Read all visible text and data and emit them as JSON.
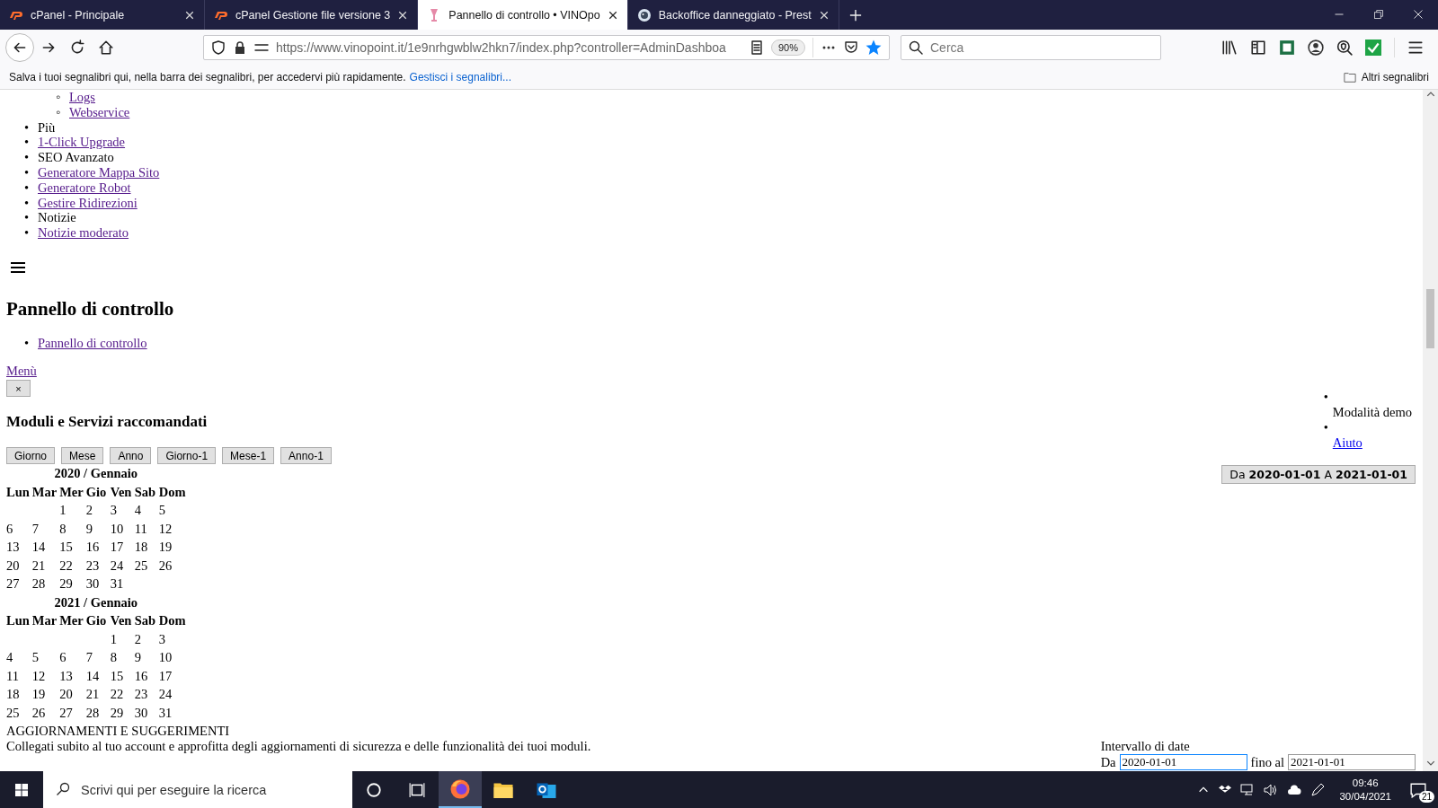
{
  "browser": {
    "tabs": [
      {
        "kind": "cpanel",
        "title": "cPanel - Principale",
        "selected": false
      },
      {
        "kind": "cpanel",
        "title": "cPanel Gestione file versione 3",
        "selected": false
      },
      {
        "kind": "wine",
        "title": "Pannello di controllo • VINOpo",
        "selected": true
      },
      {
        "kind": "prestashop",
        "title": "Backoffice danneggiato - Prest",
        "selected": false
      }
    ],
    "url": "https://www.vinopoint.it/1e9nrhgwblw2hkn7/index.php?controller=AdminDashboa",
    "zoom": "90%",
    "search": {
      "placeholder": "Cerca"
    },
    "bookmarks_bar": {
      "message": "Salva i tuoi segnalibri qui, nella barra dei segnalibri, per accedervi più rapidamente.",
      "link": "Gestisci i segnalibri...",
      "other": "Altri segnalibri"
    }
  },
  "page": {
    "nav_subitems": [
      {
        "marker": "◦",
        "label": "Logs",
        "visited": true
      },
      {
        "marker": "◦",
        "label": "Webservice",
        "visited": true
      }
    ],
    "nav_items": [
      {
        "kind": "text",
        "marker": "•",
        "label": "Più"
      },
      {
        "kind": "link",
        "marker": "•",
        "label": "1-Click Upgrade",
        "visited": true
      },
      {
        "kind": "text",
        "marker": "•",
        "label": "SEO Avanzato"
      },
      {
        "kind": "link",
        "marker": "•",
        "label": "Generatore Mappa Sito",
        "visited": true
      },
      {
        "kind": "link",
        "marker": "•",
        "label": "Generatore Robot",
        "visited": true
      },
      {
        "kind": "link",
        "marker": "•",
        "label": "Gestire Ridirezioni",
        "visited": true
      },
      {
        "kind": "text",
        "marker": "•",
        "label": "Notizie"
      },
      {
        "kind": "link",
        "marker": "•",
        "label": "Notizie moderato",
        "visited": true
      }
    ],
    "title": "Pannello di controllo",
    "breadcrumb": [
      {
        "marker": "•",
        "label": "Pannello di controllo",
        "visited": true
      }
    ],
    "menu_link": {
      "label": "Menù",
      "visited": true
    },
    "close_button": "×",
    "section_title": "Moduli e Servizi raccomandati",
    "period_buttons": [
      "Giorno",
      "Mese",
      "Anno",
      "Giorno-1",
      "Mese-1",
      "Anno-1"
    ],
    "calendars": [
      {
        "title": "2020 / Gennaio",
        "weekdays": [
          "Lun",
          "Mar",
          "Mer",
          "Gio",
          "Ven",
          "Sab",
          "Dom"
        ],
        "weeks": [
          [
            "1",
            "2",
            "3",
            "4",
            "5"
          ],
          [
            "6",
            "7",
            "8",
            "9",
            "10",
            "11",
            "12"
          ],
          [
            "13",
            "14",
            "15",
            "16",
            "17",
            "18",
            "19"
          ],
          [
            "20",
            "21",
            "22",
            "23",
            "24",
            "25",
            "26"
          ],
          [
            "27",
            "28",
            "29",
            "30",
            "31"
          ]
        ]
      },
      {
        "title": "2021 / Gennaio",
        "weekdays": [
          "Lun",
          "Mar",
          "Mer",
          "Gio",
          "Ven",
          "Sab",
          "Dom"
        ],
        "weeks": [
          [
            "1",
            "2",
            "3"
          ],
          [
            "4",
            "5",
            "6",
            "7",
            "8",
            "9",
            "10"
          ],
          [
            "11",
            "12",
            "13",
            "14",
            "15",
            "16",
            "17"
          ],
          [
            "18",
            "19",
            "20",
            "21",
            "22",
            "23",
            "24"
          ],
          [
            "25",
            "26",
            "27",
            "28",
            "29",
            "30",
            "31"
          ]
        ]
      }
    ],
    "updates": {
      "heading": "AGGIORNAMENTI E SUGGERIMENTI",
      "text": "Collegati subito al tuo account e approfitta degli aggiornamenti di sicurezza e delle funzionalità dei tuoi moduli."
    },
    "side_items": [
      {
        "kind": "text",
        "marker": "•",
        "label": "Modalità demo"
      },
      {
        "kind": "link",
        "marker": "•",
        "label": "Aiuto",
        "visited": false
      }
    ],
    "date_range_button": "Da **2020-01-01** A **2021-01-01**",
    "date_filter": {
      "title": "Intervallo di date",
      "from_label": "Da",
      "from_value": "2020-01-01",
      "from_focused": true,
      "to_label": "fino al",
      "to_value": "2021-01-01",
      "to_focused": false
    }
  },
  "taskbar": {
    "search": {
      "placeholder": "Scrivi qui per eseguire la ricerca"
    },
    "apps": [
      {
        "kind": "firefox",
        "selected": true
      },
      {
        "kind": "folder",
        "selected": false
      },
      {
        "kind": "mail",
        "selected": false
      }
    ],
    "time": "09:46",
    "date": "30/04/2021",
    "notifications": "21"
  }
}
